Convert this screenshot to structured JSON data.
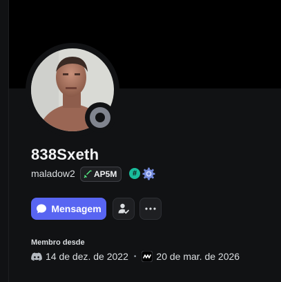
{
  "profile": {
    "display_name": "838Sxeth",
    "username": "maladow2",
    "tag": "AP5M",
    "badge_hash": "#",
    "status": "offline"
  },
  "actions": {
    "message_label": "Mensagem",
    "more_label": "•••"
  },
  "member_since": {
    "heading": "Membro desde",
    "discord_date": "14 de dez. de 2022",
    "separator": "•",
    "server_date": "20 de mar. de 2026"
  },
  "colors": {
    "accent": "#5865f2",
    "panel": "#111214",
    "status_offline": "#80848e",
    "hash_badge": "#1abc9c"
  },
  "icons": {
    "message": "chat-bubble-icon",
    "friend_action": "person-check-icon",
    "more": "ellipsis-icon",
    "discord": "discord-logo-icon",
    "server": "server-icon",
    "tag": "sword-icon",
    "gear": "gear-badge-icon"
  }
}
